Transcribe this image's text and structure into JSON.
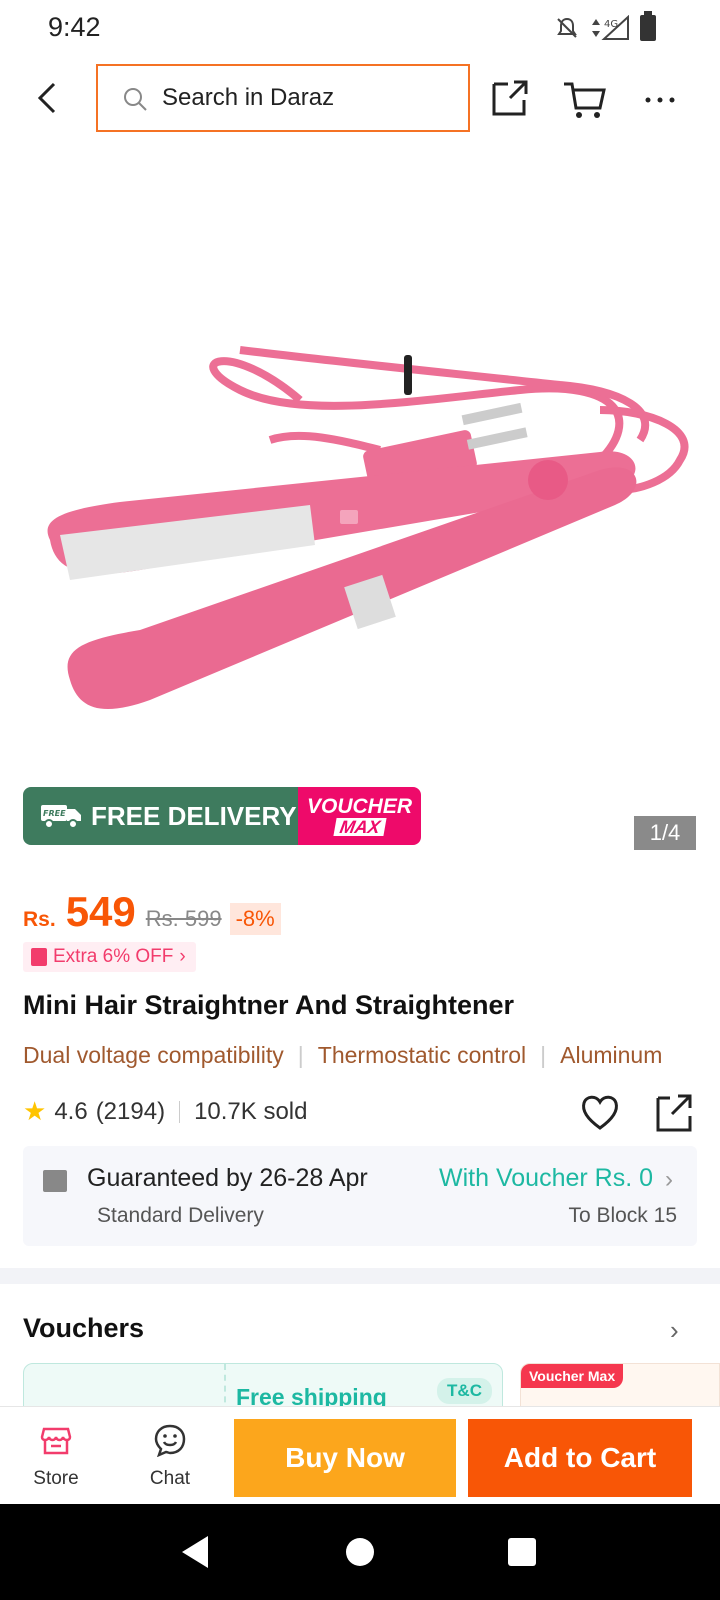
{
  "status": {
    "time": "9:42",
    "network": "4G"
  },
  "search": {
    "placeholder": "Search in Daraz"
  },
  "gallery": {
    "counter": "1/4"
  },
  "badges": {
    "free_label": "FREE",
    "free_delivery": "FREE DELIVERY",
    "voucher_line1": "VOUCHER",
    "voucher_line2": "MAX"
  },
  "price": {
    "currency": "Rs.",
    "value": "549",
    "original": "Rs. 599",
    "discount": "-8%"
  },
  "extra_offer": "Extra 6% OFF",
  "product": {
    "title": "Mini Hair Straightner And Straightener"
  },
  "features": [
    "Dual voltage compatibility",
    "Thermostatic control",
    "Aluminum"
  ],
  "rating": {
    "score": "4.6",
    "count": "(2194)",
    "sold": "10.7K sold"
  },
  "delivery": {
    "guarantee": "Guaranteed by 26-28 Apr",
    "method": "Standard Delivery",
    "voucher": "With Voucher Rs. 0",
    "location": "To Block 15"
  },
  "vouchers": {
    "heading": "Vouchers",
    "card1_title": "Free shipping",
    "card1_tc": "T&C",
    "card2_badge": "Voucher Max"
  },
  "actions": {
    "store": "Store",
    "chat": "Chat",
    "buy_now": "Buy Now",
    "add_to_cart": "Add to Cart"
  },
  "colors": {
    "accent": "#f85606",
    "buy_now": "#fca61c",
    "teal": "#1db8a2",
    "product_pink": "#ec6f95"
  }
}
